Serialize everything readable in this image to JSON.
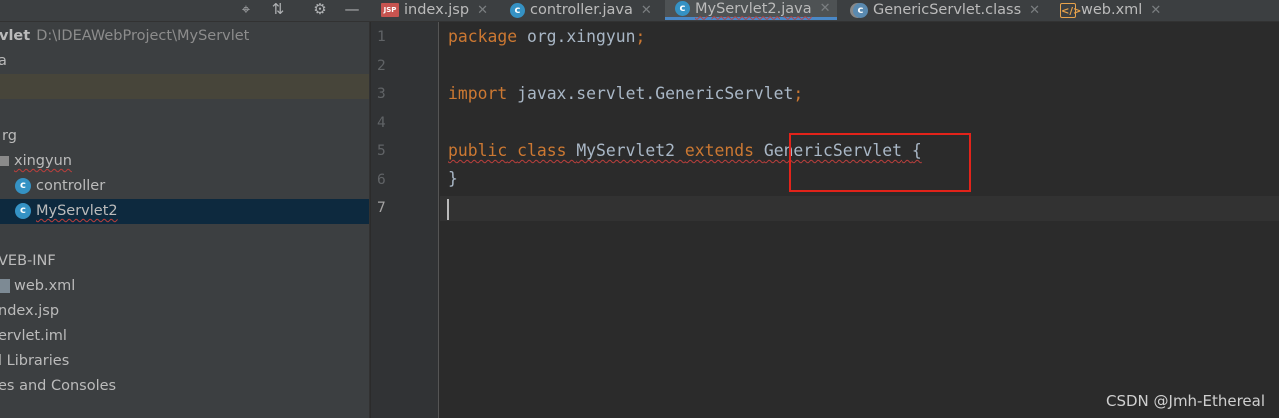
{
  "tabs": [
    {
      "label": "index.jsp",
      "icon": "jsp-file-icon"
    },
    {
      "label": "controller.java",
      "icon": "java-class-icon"
    },
    {
      "label": "MyServlet2.java",
      "icon": "java-class-icon",
      "active": true
    },
    {
      "label": "GenericServlet.class",
      "icon": "library-class-icon"
    },
    {
      "label": "web.xml",
      "icon": "xml-file-icon"
    }
  ],
  "tab_close_glyph": "✕",
  "toolbar": {
    "locate_glyph": "⌖",
    "collapse_glyph": "⇅",
    "settings_glyph": "⚙",
    "hide_glyph": "—"
  },
  "project": {
    "root_name": "vlet",
    "root_path": "D:\\IDEAWebProject\\MyServlet",
    "items": [
      {
        "label": "a"
      },
      {
        "label": ""
      },
      {
        "label": ""
      },
      {
        "label": "rg"
      },
      {
        "label": "xingyun"
      },
      {
        "label": "controller"
      },
      {
        "label": "MyServlet2"
      },
      {
        "label": ""
      },
      {
        "label": "VEB-INF"
      },
      {
        "label": "web.xml"
      },
      {
        "label": "ndex.jsp"
      },
      {
        "label": "ervlet.iml"
      },
      {
        "label": "l Libraries"
      },
      {
        "label": "es and Consoles"
      }
    ]
  },
  "editor": {
    "line_numbers": [
      "1",
      "2",
      "3",
      "4",
      "5",
      "6",
      "7"
    ],
    "current_line": "7",
    "code": {
      "l1_kw": "package",
      "l1_rest": " org.xingyun",
      "l3_kw": "import",
      "l3_rest": " javax.servlet.GenericServlet",
      "semicolon": ";",
      "l5_kw1": "public",
      "l5_kw2": "class",
      "l5_name": "MyServlet2",
      "l5_kw3": "extends",
      "l5_parent": "GenericServlet",
      "l5_brace": "{",
      "l6": "}"
    }
  },
  "watermark": "CSDN @Jmh-Ethereal",
  "colors": {
    "keyword": "#cc7832",
    "code_text": "#a9b7c6",
    "highlight_box": "#e2231a",
    "active_tab_underline": "#4a88c7"
  }
}
